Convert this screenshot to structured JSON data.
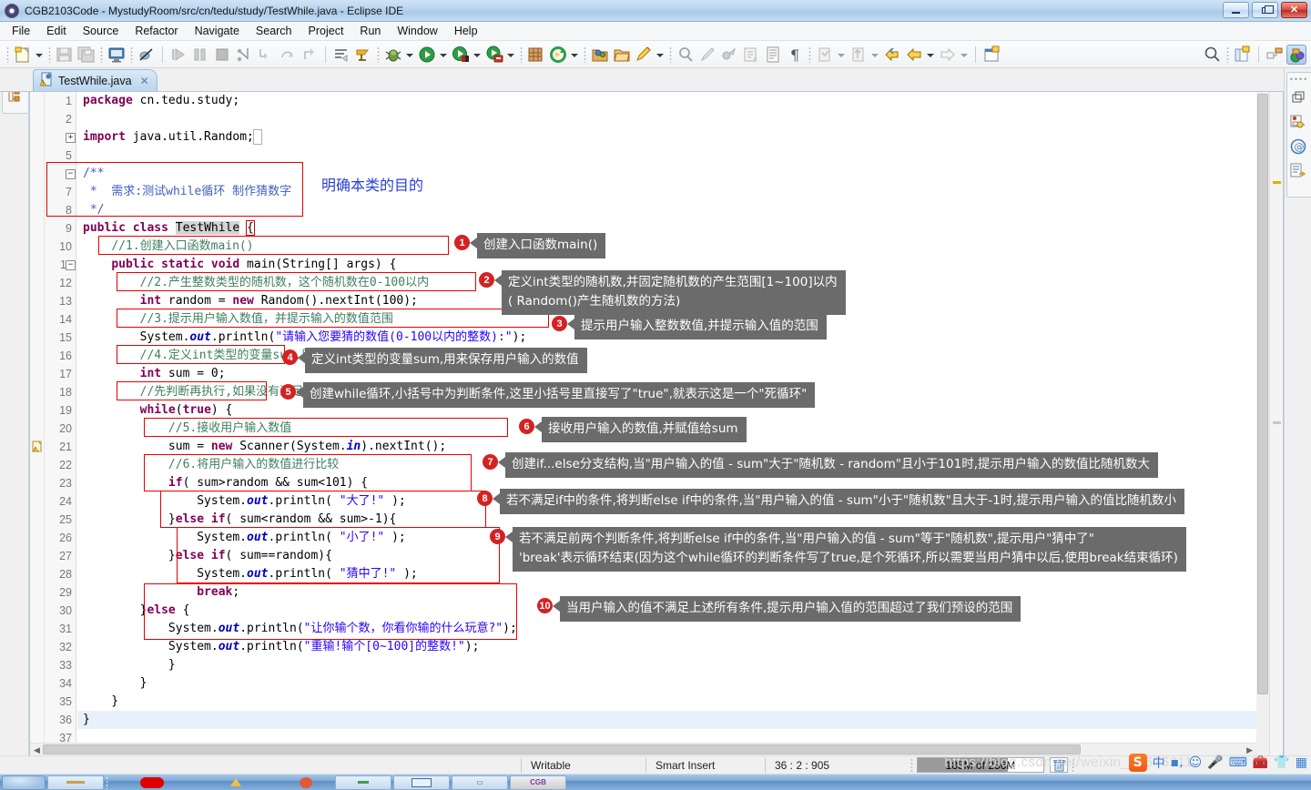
{
  "window": {
    "title": "CGB2103Code - MystudyRoom/src/cn/tedu/study/TestWhile.java - Eclipse IDE",
    "minimize_label": "Minimize",
    "maximize_label": "Restore",
    "close_label": "Close"
  },
  "menu": [
    {
      "label": "File"
    },
    {
      "label": "Edit"
    },
    {
      "label": "Source"
    },
    {
      "label": "Refactor"
    },
    {
      "label": "Navigate"
    },
    {
      "label": "Search"
    },
    {
      "label": "Project"
    },
    {
      "label": "Run"
    },
    {
      "label": "Window"
    },
    {
      "label": "Help"
    }
  ],
  "toolbar": {
    "icons": [
      "new-wizard-icon",
      "save-icon",
      "save-all-icon",
      "console-icon",
      "skip-breakpoints-icon",
      "resume-icon",
      "suspend-icon",
      "terminate-icon",
      "step-into-icon",
      "step-over-icon",
      "step-return-icon",
      "drop-to-frame-icon",
      "toggle-step-filters-icon",
      "open-task-icon",
      "debug-icon",
      "run-icon",
      "coverage-icon",
      "external-tools-icon",
      "new-java-project-icon",
      "refresh-icon",
      "open-type-icon",
      "open-package-icon",
      "annotate-icon",
      "search-icon",
      "next-annotation-icon",
      "previous-annotation-icon",
      "last-edit-location-icon",
      "back-icon",
      "forward-icon",
      "new-window-icon",
      "quick-access-icon",
      "open-perspective-icon",
      "java-perspective-icon"
    ]
  },
  "editor_tab": {
    "filename": "TestWhile.java",
    "close_label": "✕",
    "has_warning": true
  },
  "code": {
    "first_line": 1,
    "last_line": 37,
    "current_line": 36,
    "lines": [
      {
        "n": 1,
        "indent": 0,
        "html": "<span class='kw'>package</span> cn.tedu.study;"
      },
      {
        "n": 2,
        "indent": 0,
        "html": ""
      },
      {
        "n": 3,
        "indent": 0,
        "fold": "+",
        "html": "<span class='kw'>import</span> java.util.Random;<span style='outline:1px solid #b0b0b0;color:#fff'>&nbsp;</span>"
      },
      {
        "n": 5,
        "indent": 0,
        "html": ""
      },
      {
        "n": 6,
        "indent": 0,
        "fold": "-",
        "html": "<span class='doc'>/**</span>"
      },
      {
        "n": 7,
        "indent": 0,
        "html": "<span class='doc'> *  需求:测试while循环 制作猜数字</span>"
      },
      {
        "n": 8,
        "indent": 0,
        "html": "<span class='doc'> */</span>"
      },
      {
        "n": 9,
        "indent": 0,
        "html": "<span class='kw'>public</span> <span class='kw'>class</span> <span class='sel-ident'>TestWhile</span> <span class='brkt'>{</span>"
      },
      {
        "n": 10,
        "indent": 0,
        "html": "    <span class='cmt'>//1.创建入口函数main()</span>"
      },
      {
        "n": 11,
        "indent": 0,
        "fold": "-",
        "html": "    <span class='kw'>public</span> <span class='kw'>static</span> <span class='kw'>void</span> main(String[] args) {"
      },
      {
        "n": 12,
        "indent": 0,
        "html": "        <span class='cmt'>//2.产生整数类型的随机数，这个随机数在0-100以内</span>"
      },
      {
        "n": 13,
        "indent": 0,
        "html": "        <span class='kw'>int</span> random = <span class='kw'>new</span> Random().nextInt(100);"
      },
      {
        "n": 14,
        "indent": 0,
        "html": "        <span class='cmt'>//3.提示用户输入数值，并提示输入的数值范围</span>"
      },
      {
        "n": 15,
        "indent": 0,
        "html": "        System.<span class='fld'>out</span>.println(<span class='str'>\"请输入您要猜的数值(0-100以内的整数):\"</span>);"
      },
      {
        "n": 16,
        "indent": 0,
        "html": "        <span class='cmt'>//4.定义int类型的变量sum,用来保存用户输入的值</span>"
      },
      {
        "n": 17,
        "indent": 0,
        "html": "        <span class='kw'>int</span> sum = 0;"
      },
      {
        "n": 18,
        "indent": 0,
        "html": "        <span class='cmt'>//先判断再执行,如果没有满足判断条件,就不会执行</span>"
      },
      {
        "n": 19,
        "indent": 0,
        "html": "        <span class='kw'>while</span>(<span class='kw'>true</span>) {"
      },
      {
        "n": 20,
        "indent": 0,
        "html": "            <span class='cmt'>//5.接收用户输入数值</span>"
      },
      {
        "n": 21,
        "indent": 0,
        "warn": true,
        "html": "            sum = <span class='kw'>new</span> Scanner(System.<span class='fld'>in</span>).nextInt();"
      },
      {
        "n": 22,
        "indent": 0,
        "html": "            <span class='cmt'>//6.将用户输入的数值进行比较</span>"
      },
      {
        "n": 23,
        "indent": 0,
        "html": "            <span class='kw'>if</span>( sum&gt;random &amp;&amp; sum&lt;101) {"
      },
      {
        "n": 24,
        "indent": 0,
        "html": "                System.<span class='fld'>out</span>.println( <span class='str'>\"大了!\"</span> );"
      },
      {
        "n": 25,
        "indent": 0,
        "html": "            }<span class='kw'>else</span> <span class='kw'>if</span>( sum&lt;random &amp;&amp; sum&gt;-1){"
      },
      {
        "n": 26,
        "indent": 0,
        "html": "                System.<span class='fld'>out</span>.println( <span class='str'>\"小了!\"</span> );"
      },
      {
        "n": 27,
        "indent": 0,
        "html": "            }<span class='kw'>else</span> <span class='kw'>if</span>( sum==random){"
      },
      {
        "n": 28,
        "indent": 0,
        "html": "                System.<span class='fld'>out</span>.println( <span class='str'>\"猜中了!\"</span> );"
      },
      {
        "n": 29,
        "indent": 0,
        "html": "                <span class='kw'>break</span>;"
      },
      {
        "n": 30,
        "indent": 0,
        "html": "        }<span class='kw'>else</span> {"
      },
      {
        "n": 31,
        "indent": 0,
        "html": "            System.<span class='fld'>out</span>.println(<span class='str'>\"让你输个数，你看你输的什么玩意?\"</span>);"
      },
      {
        "n": 32,
        "indent": 0,
        "html": "            System.<span class='fld'>out</span>.println(<span class='str'>\"重输!输个[0~100]的整数!\"</span>);"
      },
      {
        "n": 33,
        "indent": 0,
        "html": "            }"
      },
      {
        "n": 34,
        "indent": 0,
        "html": "        }"
      },
      {
        "n": 35,
        "indent": 0,
        "html": "    }"
      },
      {
        "n": 36,
        "indent": 0,
        "html": "}"
      },
      {
        "n": 37,
        "indent": 0,
        "html": ""
      }
    ]
  },
  "blue_note": "明确本类的目的",
  "callouts": [
    {
      "num": "1",
      "text": "创建入口函数main()"
    },
    {
      "num": "2",
      "text": "定义int类型的随机数,并固定随机数的产生范围[1~100]以内\n( Random()产生随机数的方法)"
    },
    {
      "num": "3",
      "text": "提示用户输入整数数值,并提示输入值的范围"
    },
    {
      "num": "4",
      "text": "定义int类型的变量sum,用来保存用户输入的数值"
    },
    {
      "num": "5",
      "text": "创建while循环,小括号中为判断条件,这里小括号里直接写了\"true\",就表示这是一个\"死循环\""
    },
    {
      "num": "6",
      "text": "接收用户输入的数值,并赋值给sum"
    },
    {
      "num": "7",
      "text": "创建if...else分支结构,当\"用户输入的值 - sum\"大于\"随机数 - random\"且小于101时,提示用户输入的数值比随机数大"
    },
    {
      "num": "8",
      "text": "若不满足if中的条件,将判断else if中的条件,当\"用户输入的值 - sum\"小于\"随机数\"且大于-1时,提示用户输入的值比随机数小"
    },
    {
      "num": "9",
      "text": "若不满足前两个判断条件,将判断else if中的条件,当\"用户输入的值 - sum\"等于\"随机数\",提示用户\"猜中了\"\n'break'表示循环结束(因为这个while循环的判断条件写了true,是个死循环,所以需要当用户猜中以后,使用break结束循环)"
    },
    {
      "num": "10",
      "text": "当用户输入的值不满足上述所有条件,提示用户输入值的范围超过了我们预设的范围"
    }
  ],
  "right_strip": {
    "icons": [
      "restore-icon",
      "task-list-icon",
      "at-outline-icon",
      "outline-icon"
    ]
  },
  "left_strip": {
    "icons": [
      "package-explorer-icon"
    ]
  },
  "statusbar": {
    "writable": "Writable",
    "insert_mode": "Smart Insert",
    "position": "36 : 2 : 905",
    "heap": "185M of 256M",
    "heap_percent": 72,
    "trash_icon": "trash-icon"
  },
  "watermark": "https://blog.csdn.net/weixin_57575211",
  "ime": {
    "logo": "S",
    "items": [
      "中",
      "▪‚",
      "smiley-icon",
      "microphone-icon",
      "keyboard-icon",
      "toolbox-icon",
      "skin-icon",
      "apps-icon"
    ]
  },
  "colors": {
    "callout_bg": "#6b6b6b",
    "callout_num": "#d42222",
    "redbox": "#e60000",
    "keyword": "#7f0055",
    "string": "#2a00ff",
    "comment": "#3f7f5f",
    "javadoc": "#3f5fbf",
    "field": "#0000c0",
    "blue_note": "#2b3fd4",
    "titlebar": "#b9d4ef"
  }
}
